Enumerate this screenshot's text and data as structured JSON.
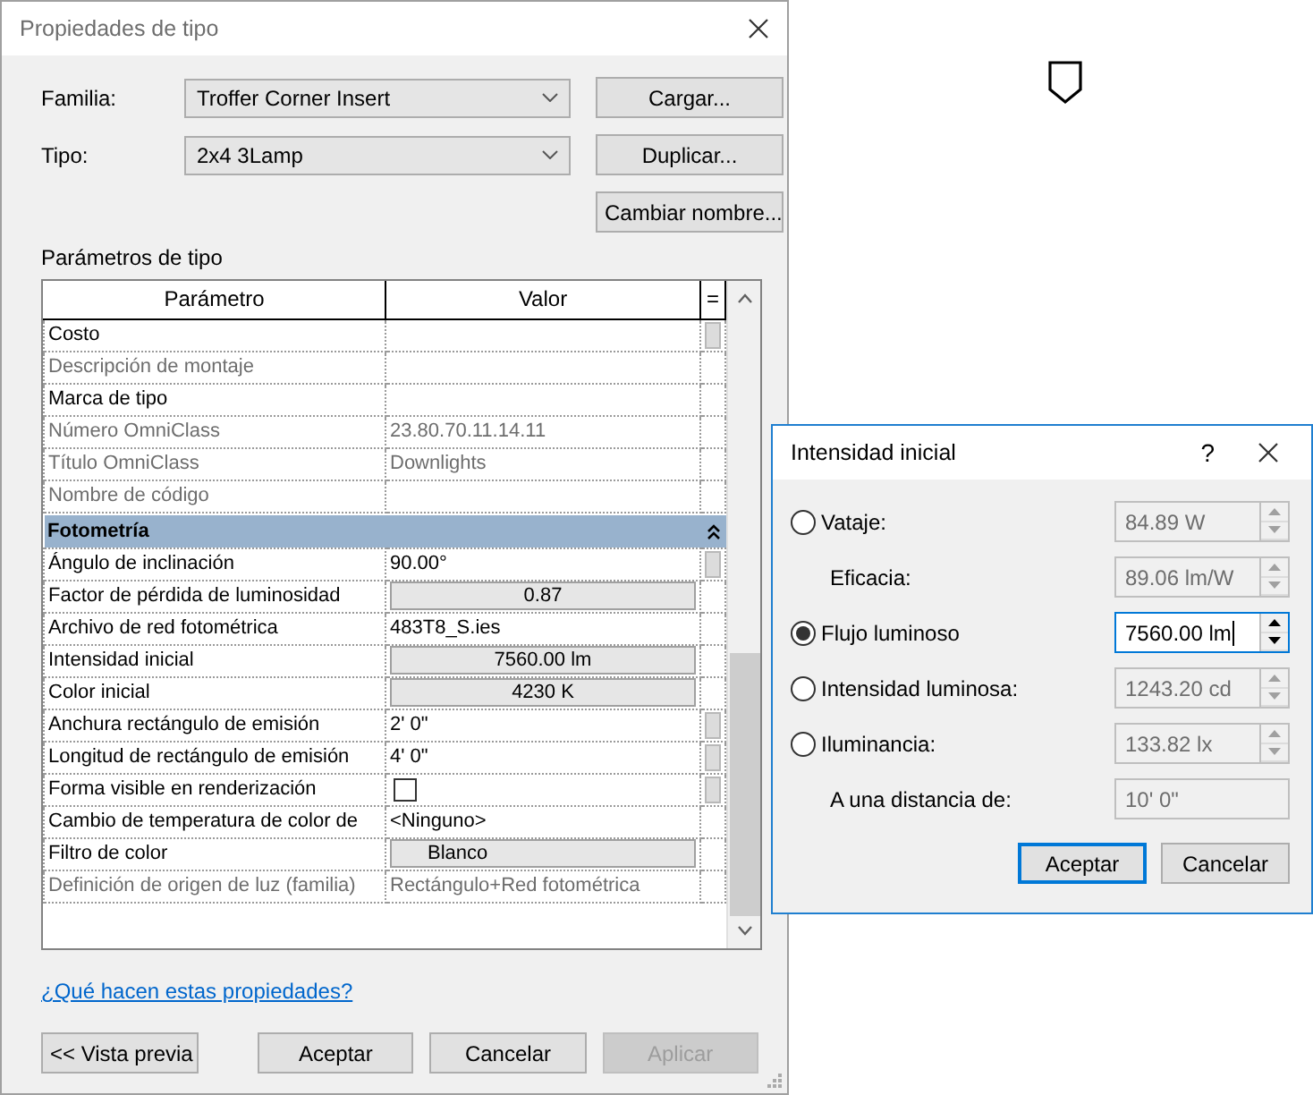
{
  "main_dialog": {
    "title": "Propiedades de tipo",
    "fields": [
      {
        "label": "Familia:",
        "value": "Troffer Corner Insert"
      },
      {
        "label": "Tipo:",
        "value": "2x4 3Lamp"
      }
    ],
    "side_buttons": [
      "Cargar...",
      "Duplicar...",
      "Cambiar nombre..."
    ],
    "section_label": "Parámetros de tipo",
    "table": {
      "columns": [
        "Parámetro",
        "Valor",
        "="
      ],
      "rows": [
        {
          "kind": "text",
          "parameter": "Costo",
          "disabled": false,
          "linked": true
        },
        {
          "kind": "text",
          "parameter": "Descripción de montaje",
          "disabled": true,
          "linked": false
        },
        {
          "kind": "text",
          "parameter": "Marca de tipo",
          "disabled": false,
          "linked": false
        },
        {
          "kind": "text",
          "parameter": "Número OmniClass",
          "value": "23.80.70.11.14.11",
          "disabled": true,
          "linked": false
        },
        {
          "kind": "text",
          "parameter": "Título OmniClass",
          "value": "Downlights",
          "disabled": true,
          "linked": false
        },
        {
          "kind": "text",
          "parameter": "Nombre de código",
          "disabled": true,
          "linked": false
        },
        {
          "kind": "group",
          "label": "Fotometría",
          "expanded": true
        },
        {
          "kind": "text",
          "parameter": "Ángulo de inclinación",
          "value": "90.00°",
          "disabled": false,
          "linked": true
        },
        {
          "kind": "button",
          "parameter": "Factor de pérdida de luminosidad",
          "value": "0.87",
          "disabled": false,
          "linked": false
        },
        {
          "kind": "text",
          "parameter": "Archivo de red fotométrica",
          "value": "483T8_S.ies",
          "disabled": false,
          "linked": false
        },
        {
          "kind": "button",
          "parameter": "Intensidad inicial",
          "value": "7560.00 lm",
          "disabled": false,
          "linked": false
        },
        {
          "kind": "button",
          "parameter": "Color inicial",
          "value": "4230 K",
          "disabled": false,
          "linked": false
        },
        {
          "kind": "text",
          "parameter": "Anchura rectángulo de emisión",
          "value": "2'  0\"",
          "disabled": false,
          "linked": true
        },
        {
          "kind": "text",
          "parameter": "Longitud de rectángulo de emisión",
          "value": "4'  0\"",
          "disabled": false,
          "linked": true
        },
        {
          "kind": "checkbox",
          "parameter": "Forma visible en renderización",
          "checked": false,
          "disabled": false,
          "linked": true
        },
        {
          "kind": "text",
          "parameter": "Cambio de temperatura de color de",
          "value": "<Ninguno>",
          "disabled": false,
          "linked": false
        },
        {
          "kind": "color",
          "parameter": "Filtro de color",
          "value": "Blanco",
          "disabled": false,
          "linked": false
        },
        {
          "kind": "text",
          "parameter": "Definición de origen de luz (familia)",
          "value": "Rectángulo+Red fotométrica",
          "disabled": true,
          "linked": false
        }
      ]
    },
    "help_link": "¿Qué hacen estas propiedades?",
    "footer_buttons": [
      {
        "label": "<< Vista previa",
        "disabled": false
      },
      {
        "label": "Aceptar",
        "disabled": false
      },
      {
        "label": "Cancelar",
        "disabled": false
      },
      {
        "label": "Aplicar",
        "disabled": true
      }
    ]
  },
  "intensity_dialog": {
    "title": "Intensidad inicial",
    "help_glyph": "?",
    "rows": [
      {
        "kind": "radio",
        "label": "Vataje:",
        "selected": false,
        "value": "84.89 W",
        "disabled": true,
        "spinner": true
      },
      {
        "kind": "sub",
        "label": "Eficacia:",
        "value": "89.06 lm/W",
        "disabled": true,
        "spinner": true
      },
      {
        "kind": "radio",
        "label": "Flujo luminoso",
        "selected": true,
        "value": "7560.00 lm",
        "disabled": false,
        "spinner": true
      },
      {
        "kind": "radio",
        "label": "Intensidad luminosa:",
        "selected": false,
        "value": "1243.20 cd",
        "disabled": true,
        "spinner": true
      },
      {
        "kind": "radio",
        "label": "Iluminancia:",
        "selected": false,
        "value": "133.82 lx",
        "disabled": true,
        "spinner": true
      },
      {
        "kind": "sub",
        "label": "A una distancia de:",
        "value": "10'  0\"",
        "disabled": true,
        "spinner": false
      }
    ],
    "buttons": [
      {
        "label": "Aceptar",
        "default": true
      },
      {
        "label": "Cancelar",
        "default": false
      }
    ]
  }
}
